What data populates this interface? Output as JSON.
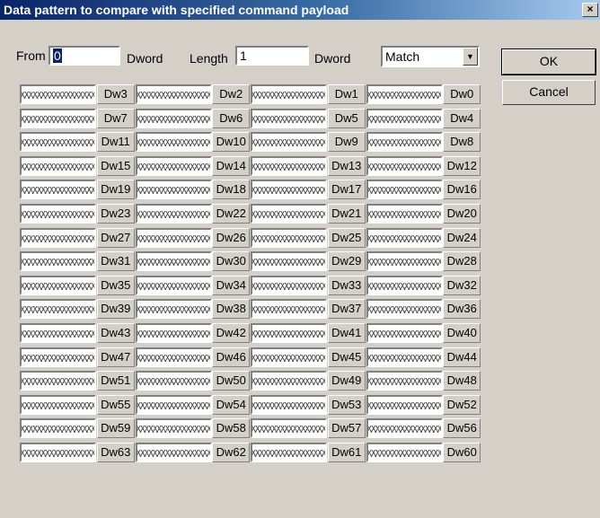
{
  "window": {
    "title": "Data pattern to compare with specified command payload",
    "close_glyph": "×"
  },
  "form": {
    "from_label": "From",
    "from_value": "0",
    "from_unit": "Dword",
    "length_label": "Length",
    "length_value": "1",
    "length_unit": "Dword",
    "match_value": "Match"
  },
  "buttons": {
    "ok": "OK",
    "cancel": "Cancel"
  },
  "grid": {
    "pattern_icon": "crosshatch-pattern",
    "rows": [
      [
        "Dw3",
        "Dw2",
        "Dw1",
        "Dw0"
      ],
      [
        "Dw7",
        "Dw6",
        "Dw5",
        "Dw4"
      ],
      [
        "Dw11",
        "Dw10",
        "Dw9",
        "Dw8"
      ],
      [
        "Dw15",
        "Dw14",
        "Dw13",
        "Dw12"
      ],
      [
        "Dw19",
        "Dw18",
        "Dw17",
        "Dw16"
      ],
      [
        "Dw23",
        "Dw22",
        "Dw21",
        "Dw20"
      ],
      [
        "Dw27",
        "Dw26",
        "Dw25",
        "Dw24"
      ],
      [
        "Dw31",
        "Dw30",
        "Dw29",
        "Dw28"
      ],
      [
        "Dw35",
        "Dw34",
        "Dw33",
        "Dw32"
      ],
      [
        "Dw39",
        "Dw38",
        "Dw37",
        "Dw36"
      ],
      [
        "Dw43",
        "Dw42",
        "Dw41",
        "Dw40"
      ],
      [
        "Dw47",
        "Dw46",
        "Dw45",
        "Dw44"
      ],
      [
        "Dw51",
        "Dw50",
        "Dw49",
        "Dw48"
      ],
      [
        "Dw55",
        "Dw54",
        "Dw53",
        "Dw52"
      ],
      [
        "Dw59",
        "Dw58",
        "Dw57",
        "Dw56"
      ],
      [
        "Dw63",
        "Dw62",
        "Dw61",
        "Dw60"
      ]
    ]
  }
}
